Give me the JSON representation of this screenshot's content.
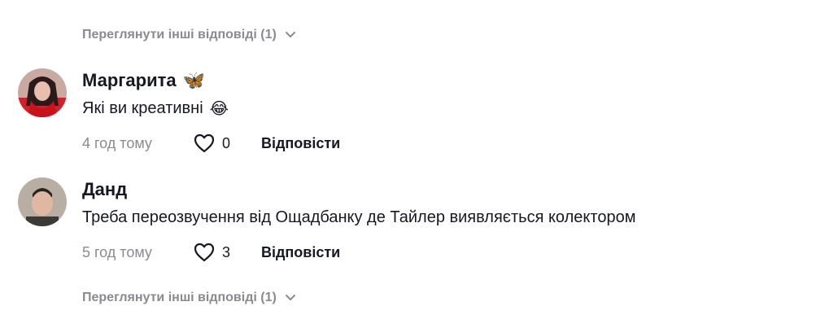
{
  "view_more_top": "Переглянути інші відповіді (1)",
  "view_more_bottom": "Переглянути інші відповіді (1)",
  "comments": [
    {
      "username": "Маргарита",
      "username_emoji": "🦋",
      "text": "Які ви креативні",
      "text_emoji": "😂",
      "time": "4 год тому",
      "likes": "0",
      "reply": "Відповісти"
    },
    {
      "username": "Данд",
      "text": "Треба переозвучення від Ощадбанку де Тайлер виявляється колектором",
      "time": "5 год тому",
      "likes": "3",
      "reply": "Відповісти"
    }
  ],
  "icons": {
    "like": "heart-icon",
    "expand": "chevron-down-icon"
  }
}
